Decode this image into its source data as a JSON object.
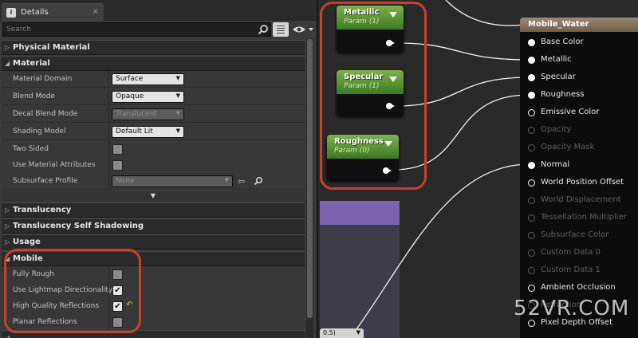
{
  "tab": {
    "label": "Details",
    "close": "×",
    "icon": "details-icon"
  },
  "search": {
    "placeholder": "Search"
  },
  "categories": {
    "physical_material": "Physical Material",
    "material": "Material",
    "translucency": "Translucency",
    "translucency_self_shadowing": "Translucency Self Shadowing",
    "usage": "Usage",
    "mobile": "Mobile"
  },
  "material": {
    "material_domain": {
      "label": "Material Domain",
      "value": "Surface"
    },
    "blend_mode": {
      "label": "Blend Mode",
      "value": "Opaque"
    },
    "decal_blend_mode": {
      "label": "Decal Blend Mode",
      "value": "Translucent"
    },
    "shading_model": {
      "label": "Shading Model",
      "value": "Default Lit"
    },
    "two_sided": {
      "label": "Two Sided",
      "checked": false
    },
    "use_material_attributes": {
      "label": "Use Material Attributes",
      "checked": false
    },
    "subsurface_profile": {
      "label": "Subsurface Profile",
      "value": "None"
    }
  },
  "mobile": {
    "fully_rough": {
      "label": "Fully Rough",
      "checked": false
    },
    "use_lightmap_directionality": {
      "label": "Use Lightmap Directionality",
      "checked": true
    },
    "high_quality_reflections": {
      "label": "High Quality Reflections",
      "checked": true
    },
    "planar_reflections": {
      "label": "Planar Reflections",
      "checked": false
    }
  },
  "graph": {
    "param_nodes": [
      {
        "title": "Metallic",
        "subtitle": "Param (1)"
      },
      {
        "title": "Specular",
        "subtitle": "Param (1)"
      },
      {
        "title": "Roughness",
        "subtitle": "Param (0)"
      }
    ],
    "small_node_label": "0.5)",
    "result_node": {
      "title": "Mobile_Water",
      "pins": [
        {
          "label": "Base Color",
          "state": "connected"
        },
        {
          "label": "Metallic",
          "state": "connected"
        },
        {
          "label": "Specular",
          "state": "connected"
        },
        {
          "label": "Roughness",
          "state": "connected"
        },
        {
          "label": "Emissive Color",
          "state": "open"
        },
        {
          "label": "Opacity",
          "state": "disabled"
        },
        {
          "label": "Opacity Mask",
          "state": "disabled"
        },
        {
          "label": "Normal",
          "state": "connected"
        },
        {
          "label": "World Position Offset",
          "state": "open"
        },
        {
          "label": "World Displacement",
          "state": "disabled"
        },
        {
          "label": "Tessellation Multiplier",
          "state": "disabled"
        },
        {
          "label": "Subsurface Color",
          "state": "disabled"
        },
        {
          "label": "Custom Data 0",
          "state": "disabled"
        },
        {
          "label": "Custom Data 1",
          "state": "disabled"
        },
        {
          "label": "Ambient Occlusion",
          "state": "open"
        },
        {
          "label": "Refraction",
          "state": "disabled"
        },
        {
          "label": "Pixel Depth Offset",
          "state": "open"
        }
      ]
    },
    "watermark": "52VR.COM"
  },
  "colors": {
    "highlight": "#c8402c",
    "param_header": "#5f9a38",
    "result_header": "#8a7762",
    "panel_bg": "#3a3a3a",
    "graph_bg": "#2a2a2a"
  }
}
